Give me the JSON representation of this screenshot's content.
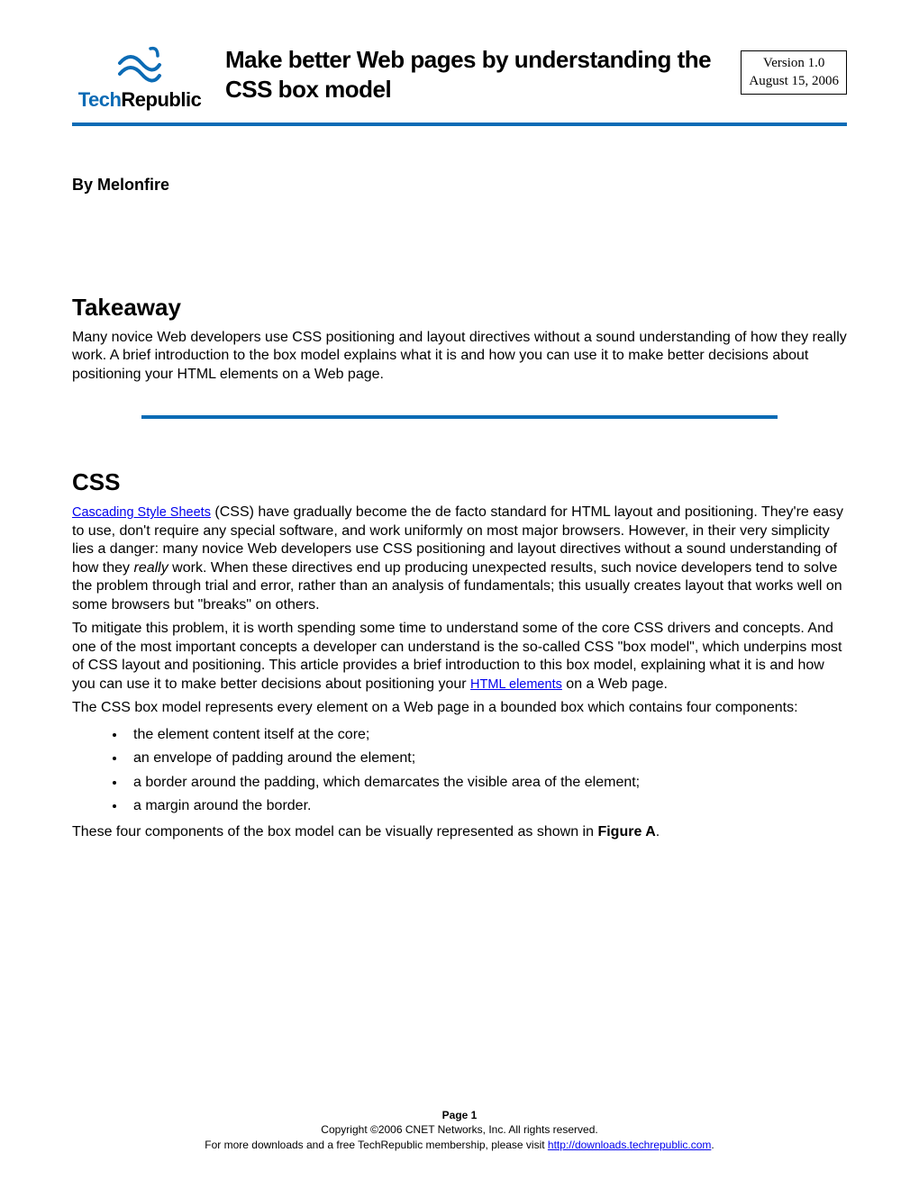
{
  "header": {
    "logo_tech": "Tech",
    "logo_republic": "Republic",
    "title": "Make better Web pages by understanding the CSS box model",
    "version": "Version 1.0",
    "date": "August 15, 2006"
  },
  "byline": "By Melonfire",
  "takeaway": {
    "heading": "Takeaway",
    "text": "Many novice Web developers use CSS positioning and layout directives without a sound understanding of how they really work. A brief introduction to the box model explains what it is and how you can use it to make better decisions about positioning your HTML elements on a Web page."
  },
  "css_section": {
    "heading": "CSS",
    "link1_text": "Cascading Style Sheets",
    "p1_after_link": " (CSS) have gradually become the de facto standard for HTML layout and positioning. They're easy to use, don't require any special software, and work uniformly on most major browsers. However, in their very simplicity lies a danger: many novice Web developers use CSS positioning and layout directives without a sound understanding of how they ",
    "p1_italic": "really",
    "p1_end": " work. When these directives end up producing unexpected results, such novice developers tend to solve the problem through trial and error, rather than an analysis of fundamentals; this usually creates layout that works well on some browsers but \"breaks\" on others.",
    "p2_before_link": "To mitigate this problem, it is worth spending some time to understand some of the core CSS drivers and concepts. And one of the most important concepts a developer can understand is the so-called CSS \"box model\", which underpins most of CSS layout and positioning. This article provides a brief introduction to this box model, explaining what it is and how you can use it to make better decisions about positioning your ",
    "link2_text": "HTML elements",
    "p2_after_link": " on a Web page.",
    "p3": "The CSS box model represents every element on a Web page in a bounded box which contains four components:",
    "bullets": [
      "the element content itself at the core;",
      "an envelope of padding around the element;",
      "a border around the padding, which demarcates the visible area of the element;",
      "a margin around the border."
    ],
    "p4_before_bold": "These four components of the box model can be visually represented as shown in ",
    "p4_bold": "Figure A",
    "p4_after_bold": "."
  },
  "footer": {
    "page": "Page 1",
    "copyright": "Copyright ©2006 CNET Networks, Inc. All rights reserved.",
    "more_before": "For more downloads and a free TechRepublic membership, please visit ",
    "more_link": "http://downloads.techrepublic.com",
    "more_after": "."
  }
}
